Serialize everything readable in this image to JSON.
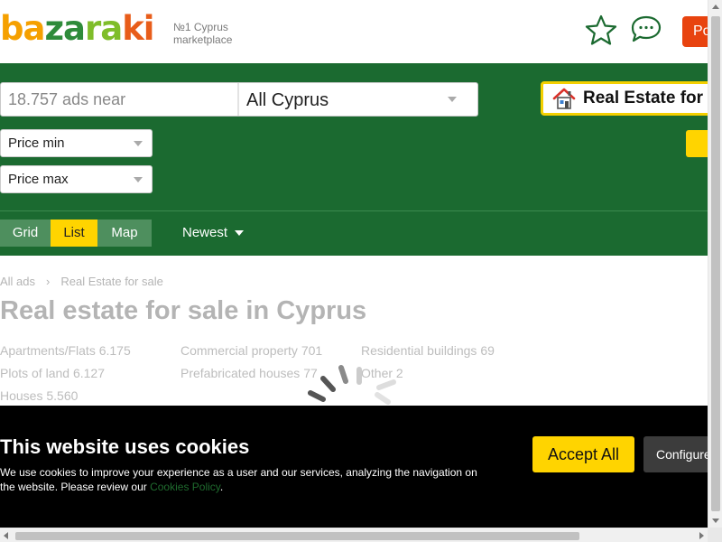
{
  "header": {
    "logo_parts": [
      "ba",
      "za",
      "ra",
      "ki"
    ],
    "tagline_line1": "№1 Cyprus",
    "tagline_line2": "marketplace",
    "post_label": "Po"
  },
  "search": {
    "placeholder": "18.757 ads near",
    "location": "All Cyprus",
    "category": "Real Estate for sale"
  },
  "filters": {
    "price_min": "Price min",
    "price_max": "Price max"
  },
  "views": {
    "grid": "Grid",
    "list": "List",
    "map": "Map",
    "active": "List"
  },
  "sort": {
    "selected": "Newest"
  },
  "breadcrumb": {
    "items": [
      "All ads",
      "Real Estate for sale"
    ]
  },
  "page_title": "Real estate for sale in Cyprus",
  "categories": [
    {
      "label": "Apartments/Flats",
      "count": "6.175"
    },
    {
      "label": "Plots of land",
      "count": "6.127"
    },
    {
      "label": "Houses",
      "count": "5.560"
    },
    {
      "label": "Commercial property",
      "count": "701"
    },
    {
      "label": "Prefabricated houses",
      "count": "77"
    },
    {
      "label": "Residential buildings",
      "count": "69"
    },
    {
      "label": "Other",
      "count": "2"
    }
  ],
  "cookie": {
    "title": "This website uses cookies",
    "text": "We use cookies to improve your experience as a user and our services, analyzing the navigation on the website. Please review our",
    "link": "Cookies Policy",
    "end": ".",
    "accept": "Accept All",
    "configure": "Configure"
  },
  "colors": {
    "brand_green": "#1b6a30",
    "accent_yellow": "#ffd400",
    "post_orange": "#e8430f"
  }
}
